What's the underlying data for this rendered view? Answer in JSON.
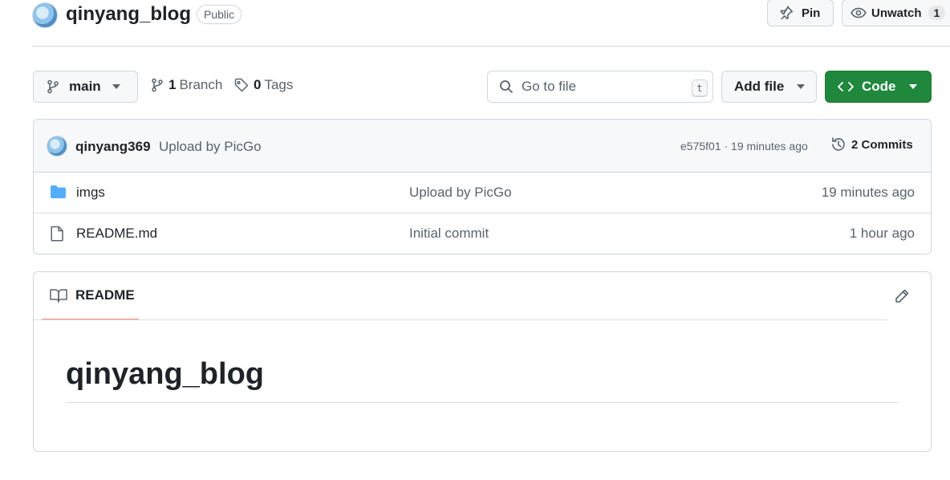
{
  "repo": {
    "name": "qinyang_blog",
    "visibility": "Public"
  },
  "actions": {
    "pin_label": "Pin",
    "watch_label": "Unwatch",
    "watch_count": "1"
  },
  "toolbar": {
    "branch": "main",
    "branches_count": "1",
    "branches_label": "Branch",
    "tags_count": "0",
    "tags_label": "Tags",
    "search_placeholder": "Go to file",
    "search_shortcut": "t",
    "add_file_label": "Add file",
    "code_label": "Code"
  },
  "latest_commit": {
    "author": "qinyang369",
    "message": "Upload by PicGo",
    "meta": "e575f01 · 19 minutes ago",
    "commits_label": "2 Commits"
  },
  "files": [
    {
      "name": "imgs",
      "type": "folder",
      "message": "Upload by PicGo",
      "time": "19 minutes ago"
    },
    {
      "name": "README.md",
      "type": "file",
      "message": "Initial commit",
      "time": "1 hour ago"
    }
  ],
  "readme": {
    "tab_label": "README",
    "heading": "qinyang_blog"
  },
  "colors": {
    "primary_green": "#1f883d",
    "folder_blue": "#54aeff",
    "tab_underline": "#fd8c73"
  },
  "icons": [
    "repo-avatar",
    "pin-icon",
    "eye-icon",
    "branch-icon",
    "tag-icon",
    "search-icon",
    "triangle-down-icon",
    "code-icon",
    "history-icon",
    "folder-icon",
    "file-icon",
    "book-icon",
    "pencil-icon"
  ]
}
